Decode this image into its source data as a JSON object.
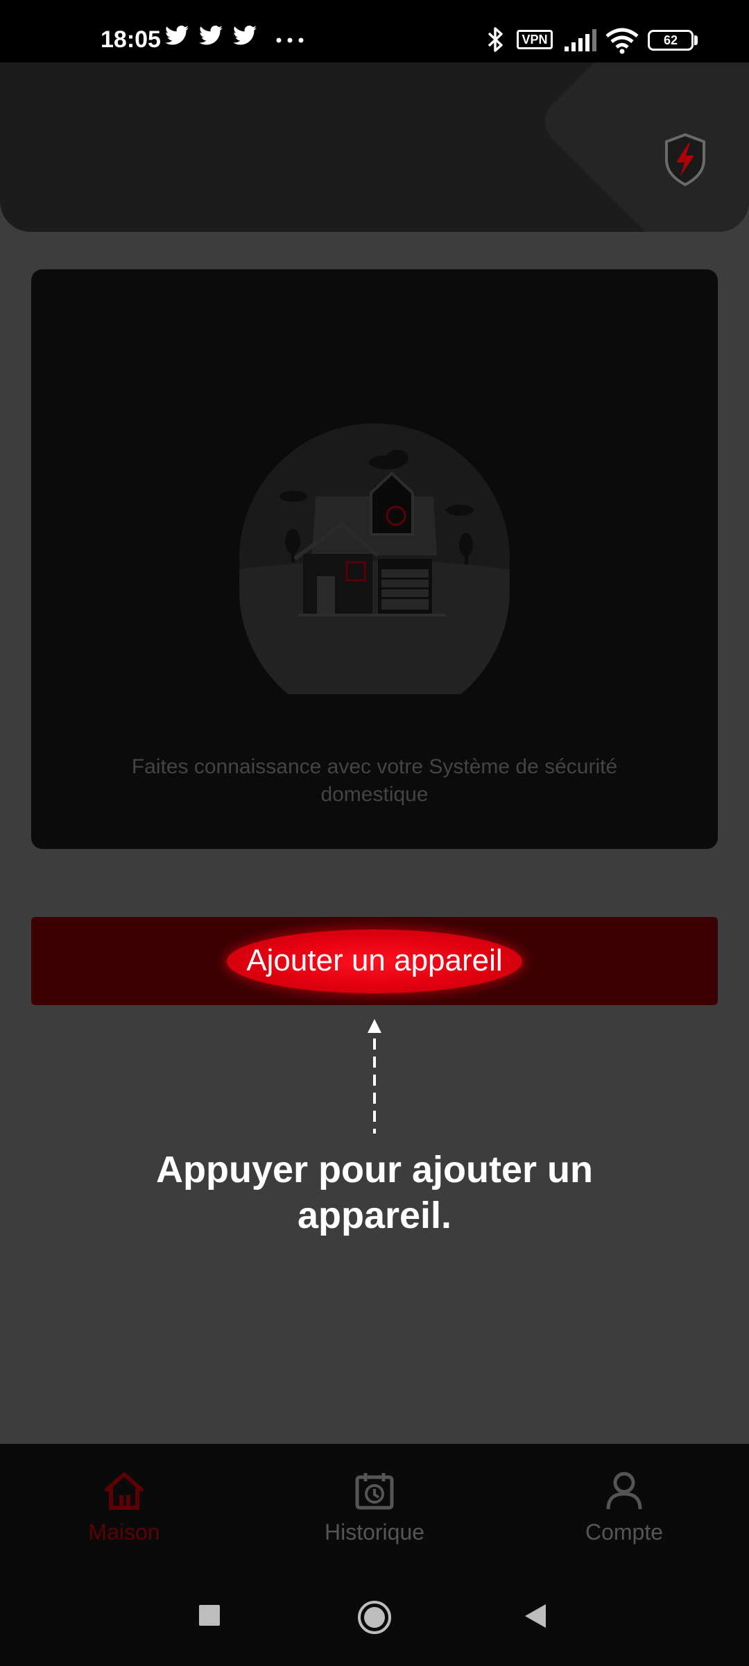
{
  "status_bar": {
    "time": "18:05",
    "vpn_label": "VPN",
    "battery": "62",
    "icons": [
      "twitter-icon",
      "twitter-icon",
      "twitter-icon",
      "more-dots-icon",
      "bluetooth-icon",
      "vpn-icon",
      "signal-icon",
      "wifi-icon",
      "battery-icon"
    ]
  },
  "header": {
    "icon": "shield-lightning-icon"
  },
  "welcome": {
    "text": "Faites connaissance avec votre Système de sécurité domestique"
  },
  "add_device": {
    "label": "Ajouter un appareil"
  },
  "hint": {
    "text": "Appuyer pour ajouter un appareil."
  },
  "nav": {
    "items": [
      {
        "label": "Maison",
        "icon": "home-icon",
        "active": true
      },
      {
        "label": "Historique",
        "icon": "history-icon",
        "active": false
      },
      {
        "label": "Compte",
        "icon": "user-icon",
        "active": false
      }
    ]
  },
  "colors": {
    "accent": "#e1000f",
    "add_bar": "#3a0003",
    "active_nav": "#5c0006"
  }
}
